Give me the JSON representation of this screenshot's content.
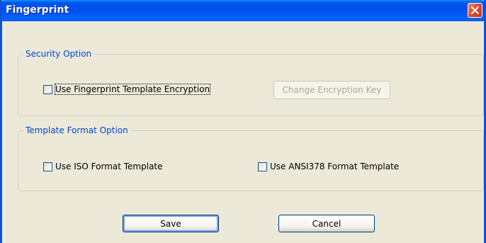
{
  "window": {
    "title": "Fingerprint"
  },
  "security": {
    "legend": "Security Option",
    "encrypt_label": "Use Fingerprint Template Encryption",
    "change_key_label": "Change Encryption Key"
  },
  "format": {
    "legend": "Template Format Option",
    "iso_label": "Use ISO Format Template",
    "ansi_label": "Use ANSI378 Format Template"
  },
  "buttons": {
    "save_label": "Save",
    "cancel_label": "Cancel"
  },
  "colors": {
    "title_bar": "#0053ee",
    "legend_text": "#0046d5",
    "face": "#ece9d8"
  },
  "icons": {
    "close": "close-icon"
  }
}
